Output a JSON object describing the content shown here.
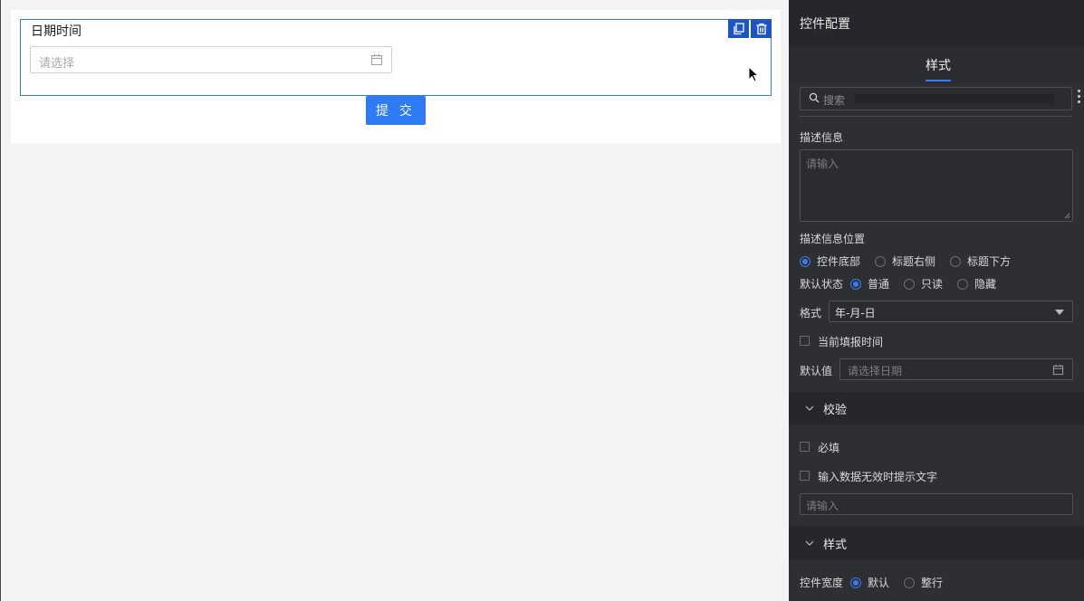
{
  "canvas": {
    "widget_title": "日期时间",
    "date_placeholder": "请选择",
    "submit_label": "提 交"
  },
  "config": {
    "header_title": "控件配置",
    "tab_label": "样式",
    "search_placeholder": "搜索",
    "desc_label": "描述信息",
    "desc_placeholder": "请输入",
    "desc_position_label": "描述信息位置",
    "desc_position_options": [
      "控件底部",
      "标题右侧",
      "标题下方"
    ],
    "desc_position_selected": "控件底部",
    "default_state_label": "默认状态",
    "default_state_options": [
      "普通",
      "只读",
      "隐藏"
    ],
    "default_state_selected": "普通",
    "format_label": "格式",
    "format_value": "年-月-日",
    "current_time_label": "当前填报时间",
    "default_value_label": "默认值",
    "default_value_placeholder": "请选择日期",
    "validation": {
      "title": "校验",
      "required_label": "必填",
      "invalid_text_label": "输入数据无效时提示文字",
      "invalid_placeholder": "请输入"
    },
    "style_section": {
      "title": "样式",
      "width_label": "控件宽度",
      "width_options": [
        "默认",
        "整行"
      ],
      "width_selected": "默认"
    }
  },
  "colors": {
    "accent": "#2f7bf5",
    "selection_border": "#3a78d8",
    "panel_bg": "#2d2f33",
    "section_header_bg": "#25272b"
  },
  "icons": [
    "copy-icon",
    "delete-icon",
    "calendar-icon",
    "search-icon",
    "more-icon",
    "chevron-down-icon",
    "cursor-icon"
  ]
}
